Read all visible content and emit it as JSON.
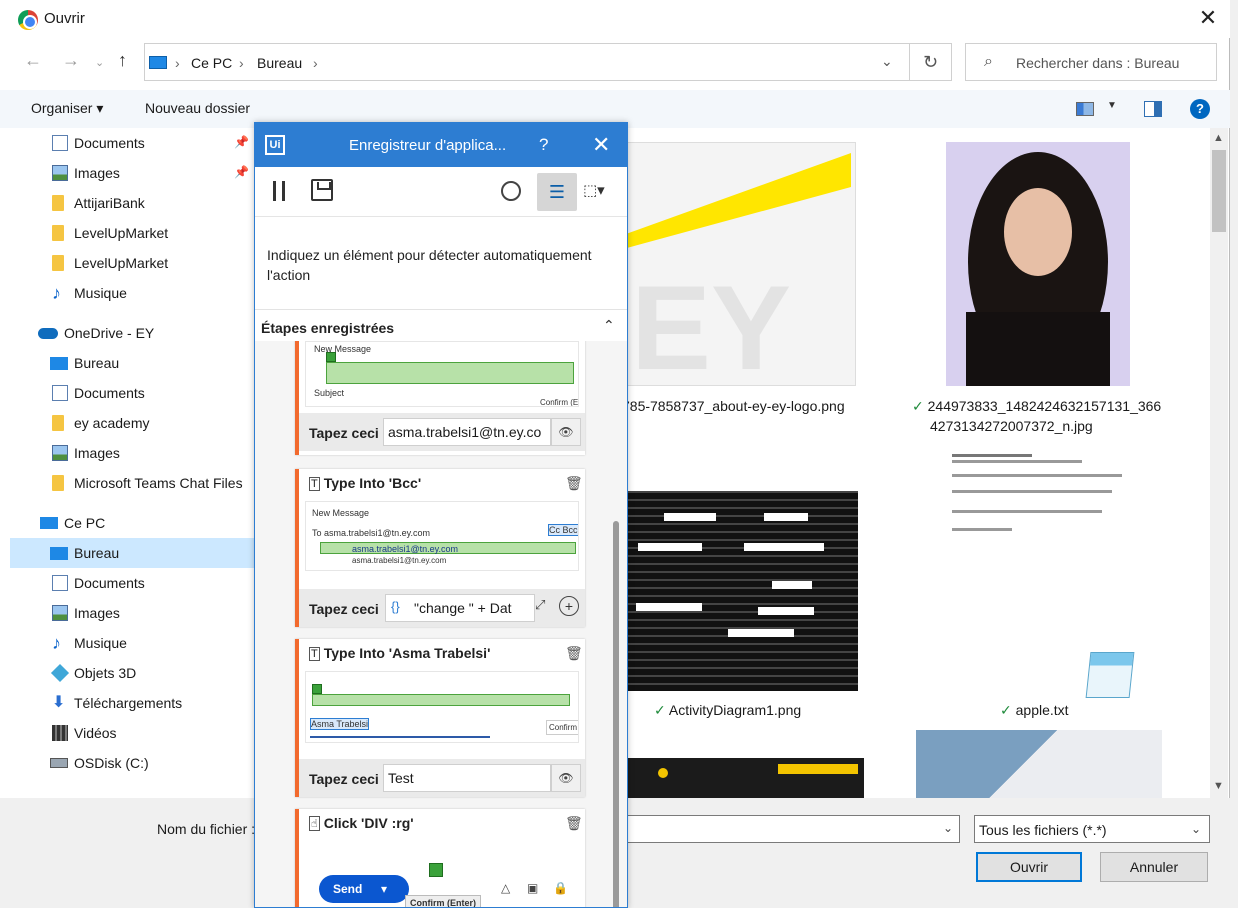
{
  "window": {
    "title": "Ouvrir",
    "close_label": "✕"
  },
  "address": {
    "crumbs": [
      "Ce PC",
      "Bureau"
    ],
    "search_placeholder": "Rechercher dans : Bureau"
  },
  "toolbar": {
    "organize_label": "Organiser ▾",
    "new_folder_label": "Nouveau dossier"
  },
  "sidebar": {
    "items": [
      {
        "label": "Documents",
        "icon": "document-icon",
        "pinned": true
      },
      {
        "label": "Images",
        "icon": "images-icon",
        "pinned": true
      },
      {
        "label": "AttijariBank",
        "icon": "folder-icon"
      },
      {
        "label": "LevelUpMarket",
        "icon": "folder-icon"
      },
      {
        "label": "LevelUpMarket",
        "icon": "folder-icon"
      },
      {
        "label": "Musique",
        "icon": "music-icon"
      },
      {
        "label": "OneDrive - EY",
        "icon": "cloud-icon"
      },
      {
        "label": "Bureau",
        "icon": "desktop-icon"
      },
      {
        "label": "Documents",
        "icon": "document-icon"
      },
      {
        "label": "ey academy",
        "icon": "folder-icon"
      },
      {
        "label": "Images",
        "icon": "images-icon"
      },
      {
        "label": "Microsoft Teams Chat Files",
        "icon": "folder-icon"
      },
      {
        "label": "Ce PC",
        "icon": "computer-icon"
      },
      {
        "label": "Bureau",
        "icon": "desktop-icon",
        "selected": true
      },
      {
        "label": "Documents",
        "icon": "document-icon"
      },
      {
        "label": "Images",
        "icon": "images-icon"
      },
      {
        "label": "Musique",
        "icon": "music-icon"
      },
      {
        "label": "Objets 3D",
        "icon": "objects-3d-icon"
      },
      {
        "label": "Téléchargements",
        "icon": "download-icon"
      },
      {
        "label": "Vidéos",
        "icon": "video-icon"
      },
      {
        "label": "OSDisk (C:)",
        "icon": "disk-icon"
      }
    ]
  },
  "files": [
    {
      "name_line1": "785-7858737_about-ey-ey-logo.png",
      "name_line2": ""
    },
    {
      "name_line1": "244973833_1482424632157131_366",
      "name_line2": "4273134272007372_n.jpg",
      "synced": true
    },
    {
      "name_line1": "ActivityDiagram1.png",
      "synced": true
    },
    {
      "name_line1": "apple.txt",
      "synced": true
    }
  ],
  "bottom": {
    "filename_label": "Nom du fichier :",
    "filename_value": "",
    "filetype": "Tous les fichiers (*.*)",
    "open_label": "Ouvrir",
    "cancel_label": "Annuler"
  },
  "recorder": {
    "logo": "Ui",
    "title": "Enregistreur d'applica...",
    "help": "?",
    "hint": "Indiquez un élément pour détecter automatiquement l'action",
    "steps_title": "Étapes enregistrées",
    "steps": [
      {
        "title": "",
        "action_label": "Tapez ceci",
        "value": "asma.trabelsi1@tn.ey.co",
        "thumb": {
          "header": "New Message",
          "subject": "Subject",
          "button": "Confirm (E"
        }
      },
      {
        "title": "Type Into 'Bcc'",
        "action_label": "Tapez ceci",
        "value": "\"change \" + Dat",
        "thumb": {
          "header": "New Message",
          "to": "To",
          "email": "asma.trabelsi1@tn.ey.com",
          "suggest_name": "asma.trabelsi1@tn.ey.com",
          "suggest_email": "asma.trabelsi1@tn.ey.com",
          "tag": "Cc Bcc"
        }
      },
      {
        "title": "Type Into 'Asma Trabelsi'",
        "action_label": "Tapez ceci",
        "value": "Test",
        "thumb": {
          "chip": "Asma Trabelsi",
          "button": "Confirm (En"
        }
      },
      {
        "title": "Click 'DIV :rg'",
        "thumb": {
          "send": "Send",
          "tooltip": "Confirm (Enter)"
        }
      }
    ]
  }
}
